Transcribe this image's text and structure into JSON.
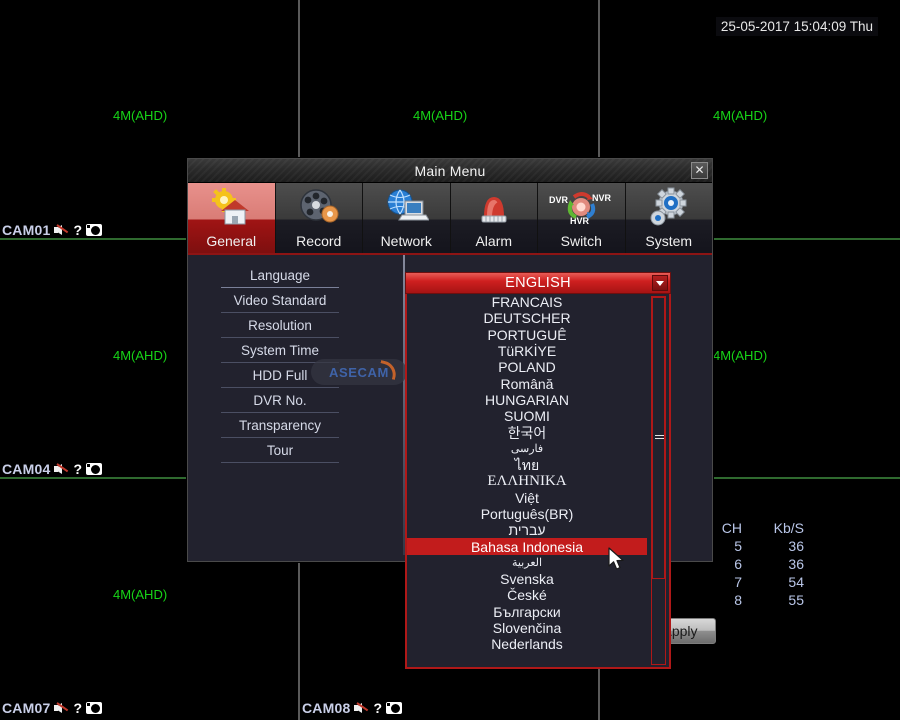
{
  "live_view": {
    "timestamp": "25-05-2017 15:04:09 Thu",
    "stream_resolution_label": "4M(AHD)",
    "resolution_labels": [
      "4M(AHD)",
      "4M(AHD)",
      "4M(AHD)",
      "4M(AHD)",
      "4M(AHD)",
      "4M(AHD)"
    ],
    "cameras": [
      {
        "name": "CAM01"
      },
      {
        "name": "CAM04"
      },
      {
        "name": "CAM07"
      },
      {
        "name": "CAM08"
      }
    ],
    "icons": {
      "mute": "speaker-muted-icon",
      "help": "question-mark-icon",
      "snapshot": "camera-icon"
    },
    "stats": {
      "headers": [
        "CH",
        "Kb/S"
      ],
      "rows": [
        {
          "ch": "5",
          "kb": "36"
        },
        {
          "ch": "6",
          "kb": "36"
        },
        {
          "ch": "7",
          "kb": "54"
        },
        {
          "ch": "8",
          "kb": "55"
        }
      ]
    }
  },
  "dialog": {
    "title": "Main Menu",
    "close_label": "✕",
    "tabs": [
      {
        "label": "General",
        "icon": "house-gear-icon",
        "active": true
      },
      {
        "label": "Record",
        "icon": "film-reel-gear-icon",
        "active": false
      },
      {
        "label": "Network",
        "icon": "globe-laptop-icon",
        "active": false
      },
      {
        "label": "Alarm",
        "icon": "siren-icon",
        "active": false
      },
      {
        "label": "Switch",
        "icon": "dvr-nvr-hvr-switch-icon",
        "active": false
      },
      {
        "label": "System",
        "icon": "gear-icon",
        "active": false
      }
    ],
    "settings": [
      {
        "label": "Language",
        "selected": true
      },
      {
        "label": "Video Standard",
        "selected": false
      },
      {
        "label": "Resolution",
        "selected": false
      },
      {
        "label": "System Time",
        "selected": false
      },
      {
        "label": "HDD Full",
        "selected": false
      },
      {
        "label": "DVR No.",
        "selected": false
      },
      {
        "label": "Transparency",
        "selected": false
      },
      {
        "label": "Tour",
        "selected": false
      }
    ],
    "apply_label": "Apply",
    "watermark": "ASECAM"
  },
  "language_dropdown": {
    "selected": "ENGLISH",
    "highlighted": "Bahasa Indonesia",
    "options": [
      {
        "label": "FRANCAIS",
        "style": "normal"
      },
      {
        "label": "DEUTSCHER",
        "style": "normal"
      },
      {
        "label": "PORTUGUÊ",
        "style": "normal"
      },
      {
        "label": "TüRKİYE",
        "style": "normal"
      },
      {
        "label": "POLAND",
        "style": "normal"
      },
      {
        "label": "Română",
        "style": "normal"
      },
      {
        "label": "HUNGARIAN",
        "style": "normal"
      },
      {
        "label": "SUOMI",
        "style": "normal"
      },
      {
        "label": "한국어",
        "style": "normal"
      },
      {
        "label": "فارسی",
        "style": "small"
      },
      {
        "label": "ไทย",
        "style": "normal"
      },
      {
        "label": "ΕΛΛΗΝΙΚΑ",
        "style": "serif"
      },
      {
        "label": "Việt",
        "style": "normal"
      },
      {
        "label": "Português(BR)",
        "style": "normal"
      },
      {
        "label": "עברית",
        "style": "normal"
      },
      {
        "label": "Bahasa Indonesia",
        "style": "normal"
      },
      {
        "label": "العربية",
        "style": "small"
      },
      {
        "label": "Svenska",
        "style": "normal"
      },
      {
        "label": "České",
        "style": "normal"
      },
      {
        "label": "Български",
        "style": "normal"
      },
      {
        "label": "Slovenčina",
        "style": "normal"
      },
      {
        "label": "Nederlands",
        "style": "normal"
      }
    ]
  },
  "colors": {
    "accent_red": "#c21c1c",
    "dialog_bg": "#22222e",
    "label_green": "#17d417",
    "cam_text": "#c9cfe8",
    "stats_text": "#b9c6e8"
  }
}
